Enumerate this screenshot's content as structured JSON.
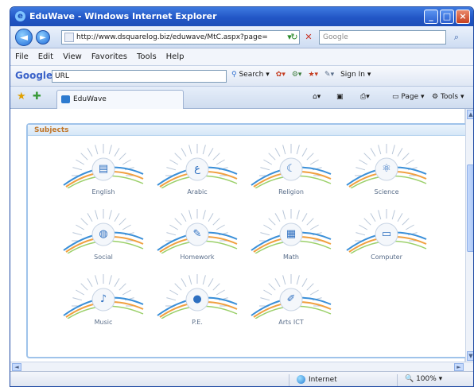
{
  "window": {
    "title": "EduWave - Windows Internet Explorer"
  },
  "address_bar": {
    "url": "http://www.dsquarelog.biz/eduwave/MtC.aspx?page=",
    "search_placeholder": "Google"
  },
  "menu": [
    "File",
    "Edit",
    "View",
    "Favorites",
    "Tools",
    "Help"
  ],
  "google_toolbar": {
    "logo": "Google",
    "field_value": "URL",
    "search_label": "Search",
    "sign_in_label": "Sign In"
  },
  "tab": {
    "title": "EduWave"
  },
  "command_bar": {
    "page_label": "Page",
    "tools_label": "Tools"
  },
  "content": {
    "header": "Subjects",
    "subjects": [
      {
        "label": "English",
        "icon": "book-icon"
      },
      {
        "label": "Arabic",
        "icon": "letters-icon"
      },
      {
        "label": "Religion",
        "icon": "crescent-icon"
      },
      {
        "label": "Science",
        "icon": "atom-icon"
      },
      {
        "label": "Social",
        "icon": "globe-icon"
      },
      {
        "label": "Homework",
        "icon": "pencil-icon"
      },
      {
        "label": "Math",
        "icon": "calculator-icon"
      },
      {
        "label": "Computer",
        "icon": "computer-icon"
      },
      {
        "label": "Music",
        "icon": "note-icon"
      },
      {
        "label": "P.E.",
        "icon": "ball-icon"
      },
      {
        "label": "Arts ICT",
        "icon": "brush-icon"
      }
    ]
  },
  "status_bar": {
    "zone": "Internet",
    "zoom": "100%"
  },
  "colors": {
    "title_bar": "#2256c6",
    "tile_accent_orange": "#f0a040",
    "tile_accent_blue": "#3a8fd8"
  }
}
